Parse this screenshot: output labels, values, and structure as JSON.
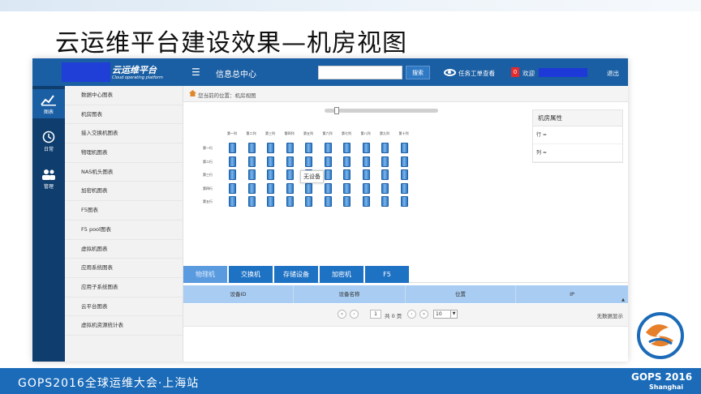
{
  "slide": {
    "title": "云运维平台建设效果—机房视图",
    "footer": "GOPS2016全球运维大会·上海站",
    "logo_brand": "GOPS 2016",
    "logo_city": "Shanghai"
  },
  "topbar": {
    "logo_name": "云运维平台",
    "logo_subtitle": "Cloud operating platform",
    "info_center": "信息总中心",
    "search_value": "",
    "search_button": "搜索",
    "task_view": "任务工单查看",
    "notice_count": "0",
    "welcome": "欢迎",
    "logout": "退出"
  },
  "rail": {
    "items": [
      {
        "label": "图表",
        "icon": "chart-icon"
      },
      {
        "label": "日常",
        "icon": "clock-icon"
      },
      {
        "label": "管理",
        "icon": "users-icon"
      }
    ]
  },
  "side_menu": {
    "items": [
      "数据中心图表",
      "机房图表",
      "接入交换机图表",
      "物理机图表",
      "NAS机头图表",
      "加密机图表",
      "F5图表",
      "F5 pool图表",
      "虚拟机图表",
      "应用系统图表",
      "应用子系统图表",
      "云平台图表",
      "虚拟机资源统计表"
    ]
  },
  "breadcrumb": {
    "text": "您当前的位置：机房视图"
  },
  "room": {
    "columns": [
      "第一列",
      "第二列",
      "第三列",
      "第四列",
      "第五列",
      "第六列",
      "第七列",
      "第八列",
      "第九列",
      "第十列"
    ],
    "rows": [
      "第一行",
      "第二行",
      "第三行",
      "第四行",
      "第五行"
    ],
    "tooltip": "无设备"
  },
  "props_panel": {
    "title": "机房属性",
    "row_label": "行 =",
    "col_label": "列 ="
  },
  "tabs": [
    "物理机",
    "交换机",
    "存储设备",
    "加密机",
    "F5"
  ],
  "table": {
    "headers": [
      "设备ID",
      "设备名称",
      "位置",
      "IP"
    ]
  },
  "pager": {
    "first": "«",
    "prev": "‹",
    "page": "1",
    "total": "共 0 页",
    "next": "›",
    "last": "»",
    "page_size": "10",
    "no_data": "无数据显示"
  },
  "colors": {
    "primary": "#1a5ea3",
    "rail": "#0e3d6e",
    "tab": "#1e72c4",
    "table_header": "#a9cdf2",
    "rack": "#2c78c8",
    "footer": "#1b6bb8"
  }
}
